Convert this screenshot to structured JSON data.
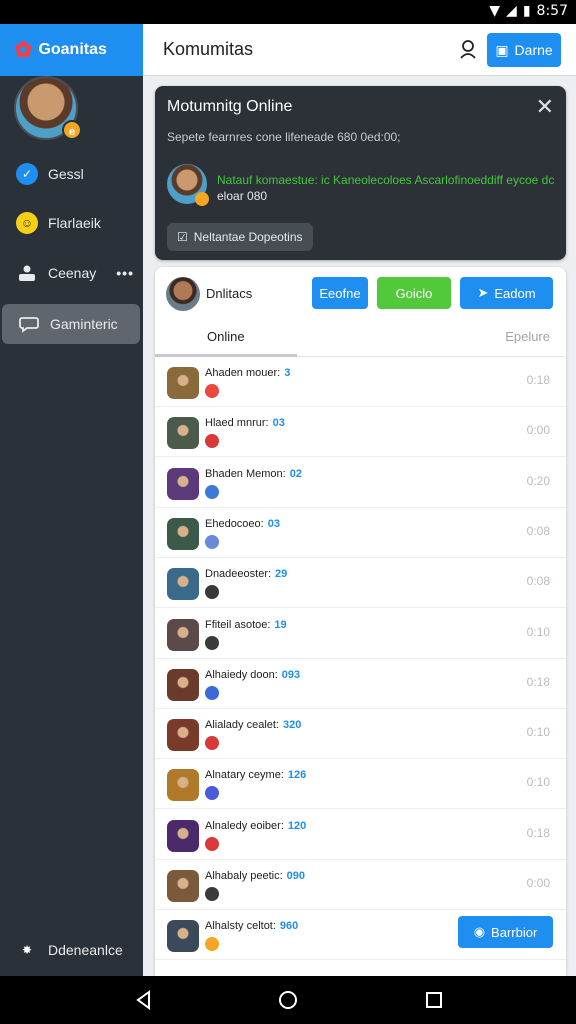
{
  "status_bar": {
    "time": "8:57"
  },
  "sidebar": {
    "brand": "Goanitas",
    "avatar_badge": "e",
    "items": [
      {
        "label": "Gessl",
        "icon": "check-icon",
        "color": "#1f8ef1"
      },
      {
        "label": "Flarlaeik",
        "icon": "smiley-icon",
        "color": "#f5d016"
      },
      {
        "label": "Ceenay",
        "icon": "group-icon",
        "more": "•••"
      },
      {
        "label": "Gaminteric",
        "icon": "chat-bubble-icon",
        "active": true
      }
    ],
    "footer": {
      "label": "Ddeneanlce",
      "icon": "sparkle-icon"
    }
  },
  "header": {
    "title": "Komumitas",
    "demo_label": "Darne"
  },
  "notification_card": {
    "title": "Motumnitg Online",
    "subtitle": "Sepete fearnres cone lifeneade 680 0ed:00;",
    "message_green": "Natauf komaestue: ic Kaneolecoloes Ascarlofinoeddiff eycoe dc",
    "message_rest": "eloar 080",
    "button_label": "Neltantae Dopeotins"
  },
  "panel": {
    "header_name": "Dnlitacs",
    "buttons": [
      {
        "label": "Eeofne",
        "color": "#1f8ef1"
      },
      {
        "label": "Goiclo",
        "color": "#52c83b"
      },
      {
        "label": "Eadom",
        "color": "#1f8ef1"
      }
    ],
    "tabs": [
      "Online",
      "Epelure"
    ],
    "rows": [
      {
        "name": "Ahaden mouer:",
        "num": "3",
        "time": "0:18",
        "bg": "#8a6a3b",
        "badge": "#e84a3b"
      },
      {
        "name": "Hlaed mnrur:",
        "num": "03",
        "time": "0:00",
        "bg": "#4b5a4a",
        "badge": "#d83a3a"
      },
      {
        "name": "Bhaden Memon:",
        "num": "02",
        "time": "0:20",
        "bg": "#5a3a7a",
        "badge": "#3b7ad8"
      },
      {
        "name": "Ehedocoeo:",
        "num": "03",
        "time": "0:08",
        "bg": "#3b5a4a",
        "badge": "#6a8ad8"
      },
      {
        "name": "Dnadeeoster:",
        "num": "29",
        "time": "0:08",
        "bg": "#3a6a8a",
        "badge": "#3a3a3a"
      },
      {
        "name": "Ffiteil asotoe:",
        "num": "19",
        "time": "0:10",
        "bg": "#5a4a4a",
        "badge": "#3a3a3a"
      },
      {
        "name": "Alhaiedy doon:",
        "num": "093",
        "time": "0:18",
        "bg": "#6a3a2a",
        "badge": "#3a6ad8"
      },
      {
        "name": "Alialady cealet:",
        "num": "320",
        "time": "0:10",
        "bg": "#7a3a2a",
        "badge": "#d83a3a"
      },
      {
        "name": "Alnatary ceyme:",
        "num": "126",
        "time": "0:10",
        "bg": "#b07a2a",
        "badge": "#4a5ad8"
      },
      {
        "name": "Alnaledy eoiber:",
        "num": "120",
        "time": "0:18",
        "bg": "#4a2a6a",
        "badge": "#d83a3a"
      },
      {
        "name": "Alhabaly peetic:",
        "num": "090",
        "time": "0:00",
        "bg": "#7a5a3a",
        "badge": "#3a3a3a"
      },
      {
        "name": "Alhalsty celtot:",
        "num": "960",
        "time": "",
        "bg": "#3a4a5a",
        "badge": "#f5a623",
        "button": "Barrbior"
      }
    ]
  },
  "colors": {
    "accent": "#1f8ef1",
    "sidebar_bg": "#2b3138",
    "card_bg": "#2c3137",
    "green": "#41c83a"
  }
}
